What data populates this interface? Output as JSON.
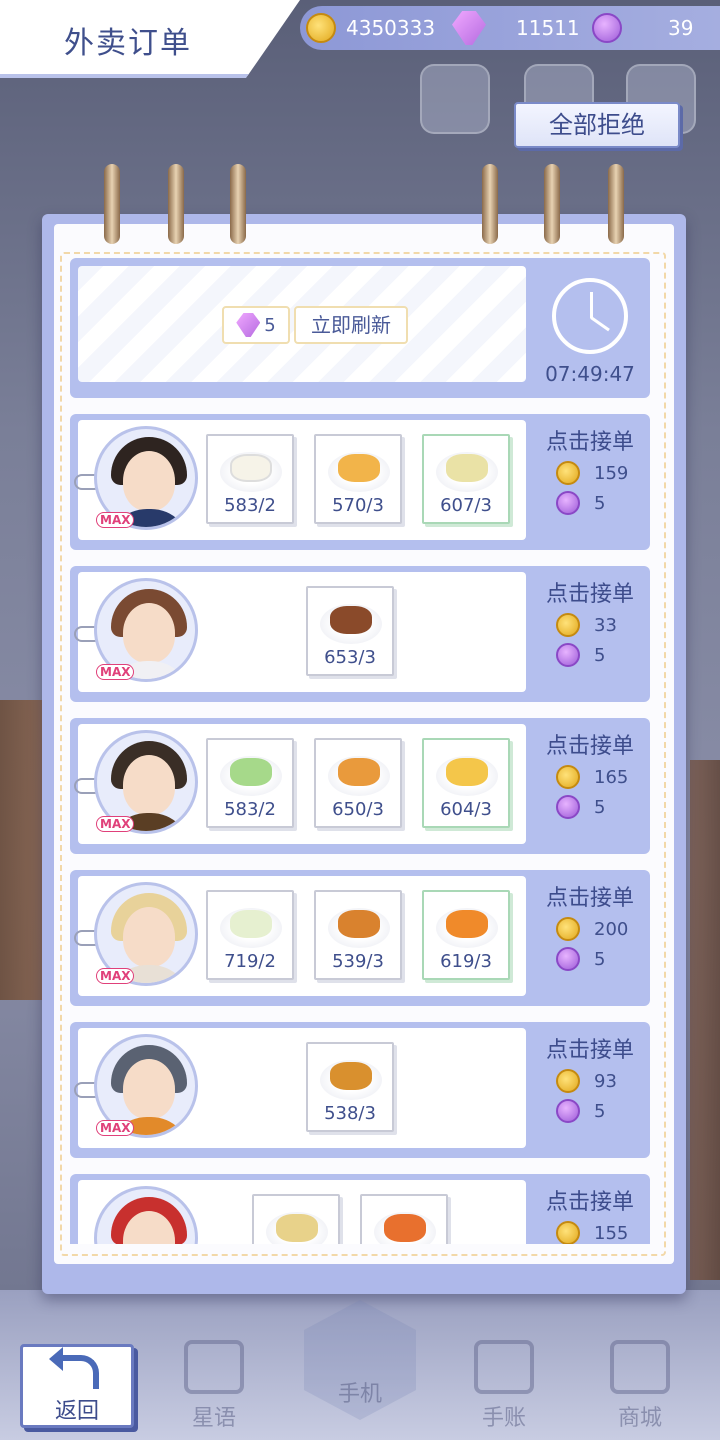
{
  "header": {
    "title": "外卖订单"
  },
  "resources": [
    {
      "icon": "gold-coin-icon",
      "value": "4350333"
    },
    {
      "icon": "crystal-plus-icon",
      "value": "11511"
    },
    {
      "icon": "heart-gem-icon",
      "value": "39"
    }
  ],
  "reject_all_label": "全部拒绝",
  "refresh": {
    "cost": "5",
    "button_label": "立即刷新",
    "timer": "07:49:47"
  },
  "orders": [
    {
      "foods": [
        {
          "count": "583/2",
          "icon": "milk-icon",
          "border": "gray"
        },
        {
          "count": "570/3",
          "icon": "omelette-icon",
          "border": "gray"
        },
        {
          "count": "607/3",
          "icon": "soup-icon",
          "border": "green"
        }
      ],
      "accept_label": "点击接单",
      "gold": "159",
      "gems": "5",
      "avatar": "girl-dark-hair",
      "max": "MAX"
    },
    {
      "foods": [
        {
          "count": "653/3",
          "icon": "coffee-icon",
          "border": "gray"
        }
      ],
      "accept_label": "点击接单",
      "gold": "33",
      "gems": "5",
      "avatar": "girl-brown-curls",
      "max": "MAX"
    },
    {
      "foods": [
        {
          "count": "583/2",
          "icon": "green-tea-icon",
          "border": "gray"
        },
        {
          "count": "650/3",
          "icon": "pancake-icon",
          "border": "gray"
        },
        {
          "count": "604/3",
          "icon": "cake-cube-icon",
          "border": "green"
        }
      ],
      "accept_label": "点击接单",
      "gold": "165",
      "gems": "5",
      "avatar": "old-man-cap",
      "max": "MAX"
    },
    {
      "foods": [
        {
          "count": "719/2",
          "icon": "lemonade-icon",
          "border": "gray"
        },
        {
          "count": "539/3",
          "icon": "burger-icon",
          "border": "gray"
        },
        {
          "count": "619/3",
          "icon": "orange-dessert-icon",
          "border": "green"
        }
      ],
      "accept_label": "点击接单",
      "gold": "200",
      "gems": "5",
      "avatar": "blonde-woman",
      "max": "MAX"
    },
    {
      "foods": [
        {
          "count": "538/3",
          "icon": "fried-fish-icon",
          "border": "gray"
        }
      ],
      "accept_label": "点击接单",
      "gold": "93",
      "gems": "5",
      "avatar": "man-beanie",
      "max": "MAX"
    },
    {
      "foods": [
        {
          "count": "",
          "icon": "sandwich-icon",
          "border": "gray"
        },
        {
          "count": "",
          "icon": "pasta-icon",
          "border": "gray"
        }
      ],
      "accept_label": "点击接单",
      "gold": "155",
      "gems": "",
      "avatar": "girl-red-helmet",
      "max": ""
    }
  ],
  "bottom_nav": {
    "back_label": "返回",
    "items": [
      "星语",
      "手机",
      "手账",
      "商城"
    ]
  },
  "colors": {
    "accent": "#3f4f8c",
    "panel": "#b4bfee",
    "gold": "#e1a81c",
    "gem": "#9d5cd8"
  }
}
